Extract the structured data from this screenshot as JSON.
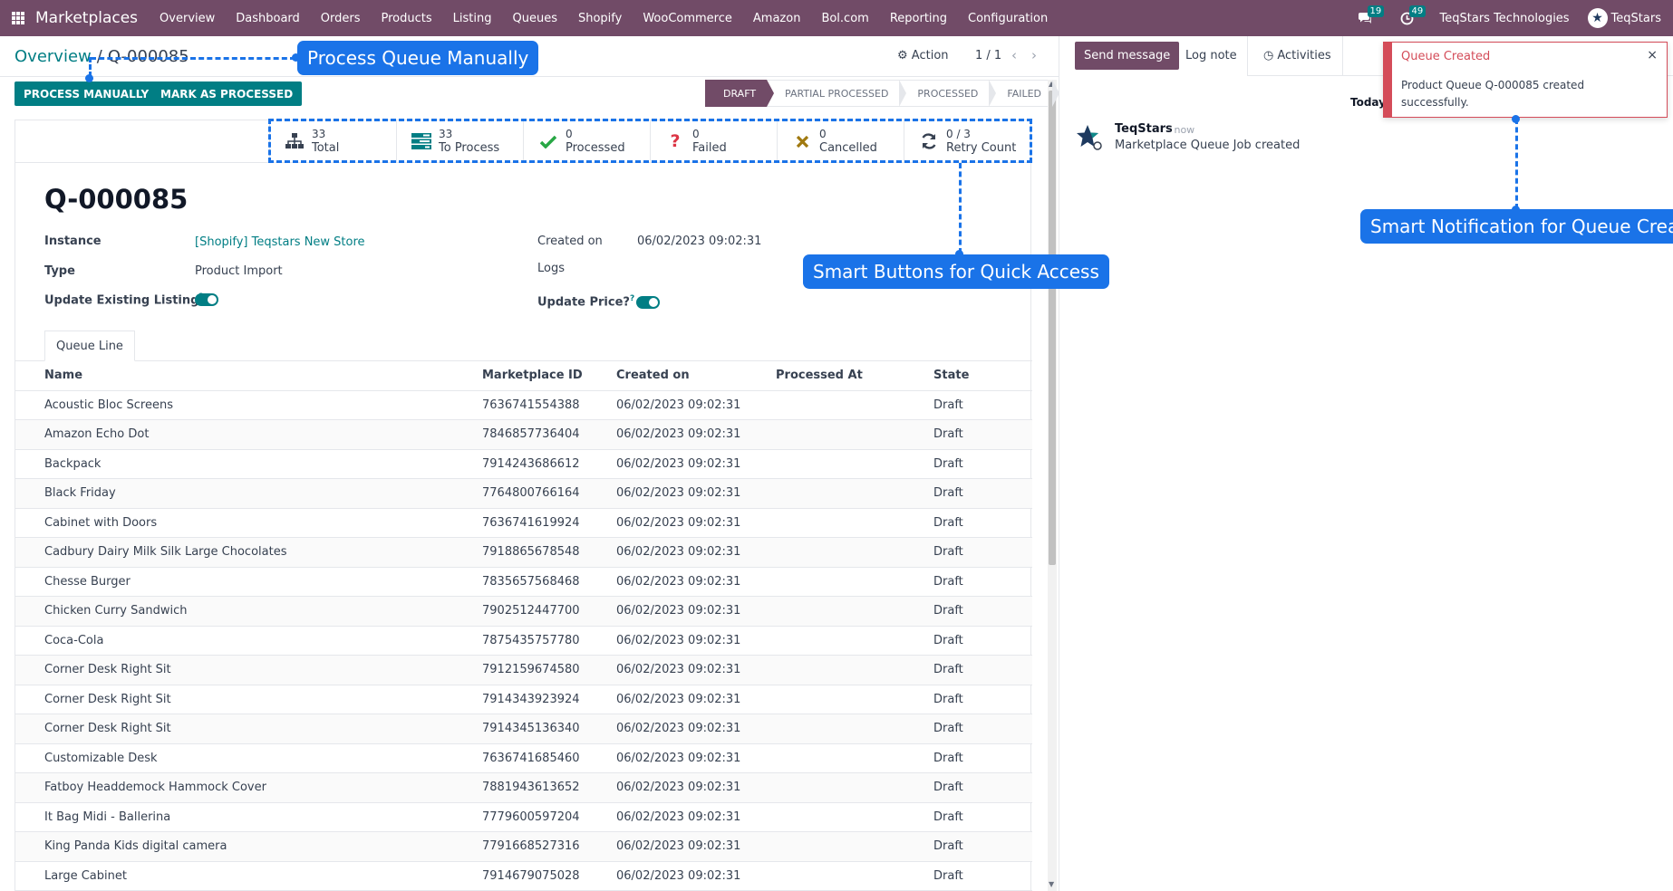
{
  "navbar": {
    "brand": "Marketplaces",
    "menu": [
      "Overview",
      "Dashboard",
      "Orders",
      "Products",
      "Listing",
      "Queues",
      "Shopify",
      "WooCommerce",
      "Amazon",
      "Bol.com",
      "Reporting",
      "Configuration"
    ],
    "messages_count": "19",
    "activities_count": "49",
    "company": "TeqStars Technologies",
    "user": "TeqStars"
  },
  "control": {
    "breadcrumb_parent": "Overview",
    "breadcrumb_sep": "/",
    "breadcrumb_current": "Q-000085",
    "action_label": "Action",
    "pager": "1 / 1",
    "process_manually": "PROCESS MANUALLY",
    "mark_processed": "MARK AS PROCESSED"
  },
  "statusbar": {
    "stages": [
      "DRAFT",
      "PARTIAL PROCESSED",
      "PROCESSED",
      "FAILED"
    ],
    "active": "DRAFT"
  },
  "smart_buttons": [
    {
      "value": "33",
      "label": "Total",
      "icon": "sitemap-icon",
      "color": "#374151"
    },
    {
      "value": "33",
      "label": "To Process",
      "icon": "tasks-icon",
      "color": "#017e84"
    },
    {
      "value": "0",
      "label": "Processed",
      "icon": "check-icon",
      "color": "#28a745"
    },
    {
      "value": "0",
      "label": "Failed",
      "icon": "question-icon",
      "color": "#dc3545"
    },
    {
      "value": "0",
      "label": "Cancelled",
      "icon": "times-icon",
      "color": "#a0790f"
    },
    {
      "value": "0 / 3",
      "label": "Retry Count",
      "icon": "refresh-icon",
      "color": "#374151"
    }
  ],
  "record": {
    "title": "Q-000085",
    "instance_label": "Instance",
    "instance_value": "[Shopify] Teqstars New Store",
    "type_label": "Type",
    "type_value": "Product Import",
    "update_listing_label": "Update Existing Listing",
    "created_on_label": "Created on",
    "created_on_value": "06/02/2023 09:02:31",
    "logs_label": "Logs",
    "update_price_label": "Update Price?",
    "help_mark": "?"
  },
  "tab": {
    "label": "Queue Line"
  },
  "table": {
    "headers": [
      "Name",
      "Marketplace ID",
      "Created on",
      "Processed At",
      "State"
    ],
    "rows": [
      [
        "Acoustic Bloc Screens",
        "7636741554388",
        "06/02/2023 09:02:31",
        "",
        "Draft"
      ],
      [
        "Amazon Echo Dot",
        "7846857736404",
        "06/02/2023 09:02:31",
        "",
        "Draft"
      ],
      [
        "Backpack",
        "7914243686612",
        "06/02/2023 09:02:31",
        "",
        "Draft"
      ],
      [
        "Black Friday",
        "7764800766164",
        "06/02/2023 09:02:31",
        "",
        "Draft"
      ],
      [
        "Cabinet with Doors",
        "7636741619924",
        "06/02/2023 09:02:31",
        "",
        "Draft"
      ],
      [
        "Cadbury Dairy Milk Silk Large Chocolates",
        "7918865678548",
        "06/02/2023 09:02:31",
        "",
        "Draft"
      ],
      [
        "Chesse Burger",
        "7835657568468",
        "06/02/2023 09:02:31",
        "",
        "Draft"
      ],
      [
        "Chicken Curry Sandwich",
        "7902512447700",
        "06/02/2023 09:02:31",
        "",
        "Draft"
      ],
      [
        "Coca-Cola",
        "7875435757780",
        "06/02/2023 09:02:31",
        "",
        "Draft"
      ],
      [
        "Corner Desk Right Sit",
        "7912159674580",
        "06/02/2023 09:02:31",
        "",
        "Draft"
      ],
      [
        "Corner Desk Right Sit",
        "7914343923924",
        "06/02/2023 09:02:31",
        "",
        "Draft"
      ],
      [
        "Corner Desk Right Sit",
        "7914345136340",
        "06/02/2023 09:02:31",
        "",
        "Draft"
      ],
      [
        "Customizable Desk",
        "7636741685460",
        "06/02/2023 09:02:31",
        "",
        "Draft"
      ],
      [
        "Fatboy Headdemock Hammock Cover",
        "7881943613652",
        "06/02/2023 09:02:31",
        "",
        "Draft"
      ],
      [
        "It Bag Midi - Ballerina",
        "7779600597204",
        "06/02/2023 09:02:31",
        "",
        "Draft"
      ],
      [
        "King Panda Kids digital camera",
        "7791668527316",
        "06/02/2023 09:02:31",
        "",
        "Draft"
      ],
      [
        "Large Cabinet",
        "7914679075028",
        "06/02/2023 09:02:31",
        "",
        "Draft"
      ]
    ]
  },
  "chatter": {
    "send_message": "Send message",
    "log_note": "Log note",
    "activities": "Activities",
    "today": "Today",
    "author": "TeqStars",
    "time": "- now",
    "body": "Marketplace Queue Job created"
  },
  "toast": {
    "title": "Queue Created",
    "body": "Product Queue Q-000085 created successfully.",
    "close": "×"
  },
  "callouts": {
    "process_manually": "Process Queue Manually",
    "smart_buttons": "Smart Buttons for Quick Access",
    "smart_notification": "Smart Notification for Queue Create"
  },
  "colors": {
    "brand": "#714B67",
    "primary": "#017e84",
    "annotation": "#1a73e8",
    "danger": "#d44c59"
  }
}
